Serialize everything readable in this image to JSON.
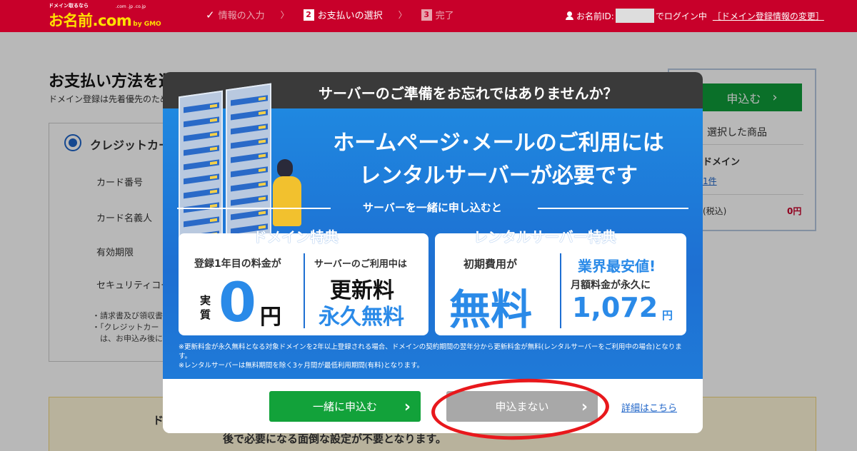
{
  "header": {
    "logo_tagline": "ドメイン取るなら",
    "logo_text": "お名前.com",
    "logo_tlds": ".com .jp .co.jp",
    "logo_suffix": "by GMO",
    "steps": [
      {
        "label": "情報の入力",
        "state": "done"
      },
      {
        "num": "2",
        "label": "お支払いの選択",
        "state": "current"
      },
      {
        "num": "3",
        "label": "完了",
        "state": "upcoming"
      }
    ],
    "user_prefix": "お名前ID:",
    "user_suffix": "でログイン中",
    "change_link": "［ドメイン登録情報の変更］"
  },
  "page": {
    "title": "お支払い方法を選択してください",
    "subtitle": "ドメイン登録は先着優先のため",
    "payment_option": "クレジットカード",
    "fields": [
      "カード番号",
      "カード名義人",
      "有効期限",
      "セキュリティコード"
    ],
    "notes": [
      "・請求書及び領収書",
      "・「クレジットカー",
      "　は、お申込み後に"
    ],
    "banner_label": "ド",
    "banner_line": "後で必要になる面倒な設定が不要となります。"
  },
  "sidebar": {
    "apply_label": "申込む",
    "selected_label": "選択した商品",
    "domain_label": "ドメイン",
    "count_label": "1件",
    "tax_label": "(税込)",
    "price": "0円"
  },
  "modal": {
    "header": "サーバーのご準備をお忘れではありませんか？",
    "headline_1": "ホームページ･メールのご利用には",
    "headline_2": "レンタルサーバーが必要です",
    "strip_text": "サーバーを一緒に申し込むと",
    "domain_card": {
      "tag": "ドメイン特典",
      "left_small": "登録1年目の料金が",
      "left_prefix": "実質",
      "left_big": "0",
      "left_unit": "円",
      "right_small": "サーバーのご利用中は",
      "right_big_1": "更新料",
      "right_big_2": "永久無料"
    },
    "server_card": {
      "tag": "レンタルサーバー特典",
      "left_small": "初期費用が",
      "left_big": "無料",
      "right_big_1": "業界最安値!",
      "right_small": "月額料金が永久に",
      "right_price": "1,072",
      "right_unit": "円"
    },
    "footnote_1": "※更新料金が永久無料となる対象ドメインを2年以上登録される場合、ドメインの契約期間の翌年分から更新料金が無料(レンタルサーバーをご利用中の場合)となります。",
    "footnote_2": "※レンタルサーバーは無料期間を除く3ヶ月間が最低利用期間(有料)となります。",
    "btn_together": "一緒に申込む",
    "btn_decline": "申込まない",
    "details_link": "詳細はこちら"
  },
  "colors": {
    "brand_red": "#c8002a",
    "modal_blue": "#1e6fd2",
    "cta_green": "#12a23a",
    "annotation_red": "#e8181c"
  }
}
